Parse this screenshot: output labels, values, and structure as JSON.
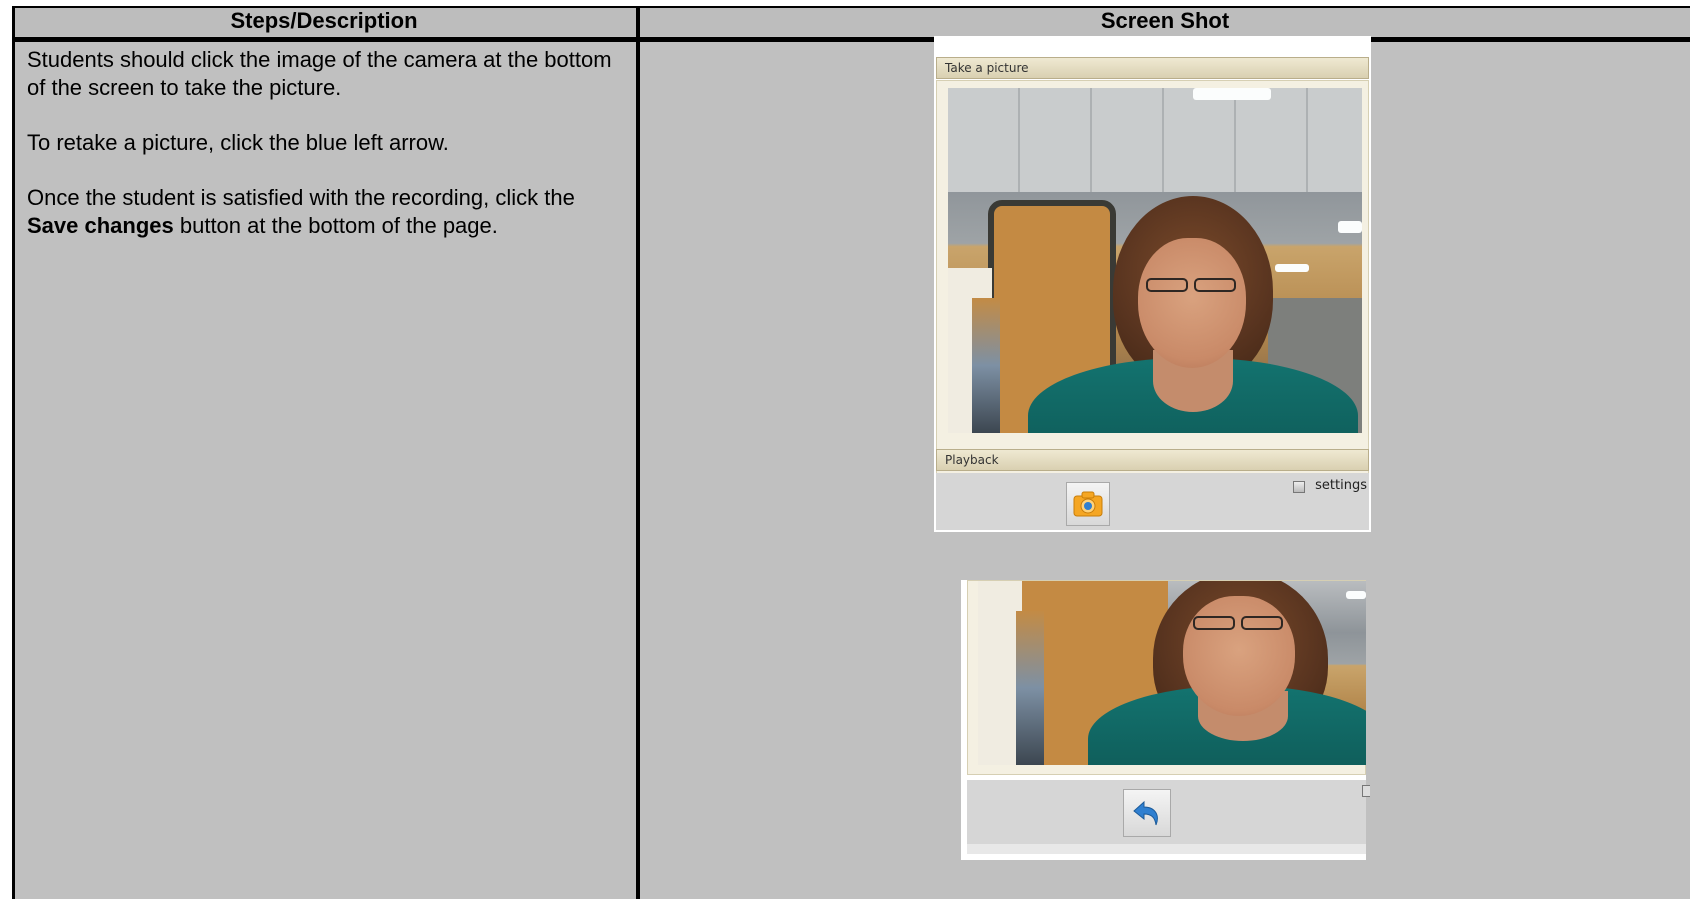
{
  "table": {
    "headers": {
      "steps": "Steps/Description",
      "screenshot": "Screen Shot"
    }
  },
  "steps": {
    "para1": "Students should click the image of the camera at the bottom of the screen to take the picture.",
    "para2": "To retake a picture, click the blue left arrow.",
    "para3_prefix": "Once the student is satisfied with the recording, click the ",
    "para3_bold": "Save changes",
    "para3_suffix": " button at the bottom of the page."
  },
  "widget": {
    "take_picture_label": "Take a picture",
    "playback_label": "Playback",
    "settings_label": "settings",
    "camera_icon": "camera-icon",
    "retake_icon": "blue-left-arrow-icon",
    "accent_colors": {
      "camera": "#f5a623",
      "arrow": "#2f7fd0"
    }
  }
}
